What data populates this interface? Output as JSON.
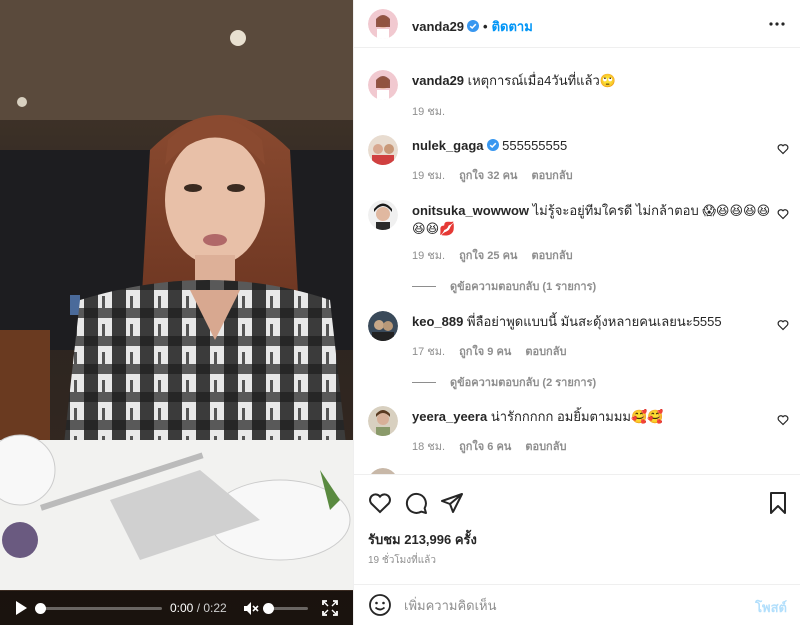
{
  "video": {
    "current_time": "0:00",
    "separator": " / ",
    "duration": "0:22",
    "progress": 0,
    "volume": 0,
    "muted": true
  },
  "header": {
    "username": "vanda29",
    "separator": "•",
    "follow_label": "ติดตาม",
    "more_icon": "more-horizontal-icon"
  },
  "caption": {
    "username": "vanda29",
    "text": "เหตุการณ์เมื่อ4วันที่แล้ว",
    "emoji": "🙄",
    "time": "19 ชม."
  },
  "comments": [
    {
      "username": "nulek_gaga",
      "verified": true,
      "text": "555555555",
      "time": "19 ชม.",
      "likes": "ถูกใจ 32 คน",
      "reply_label": "ตอบกลับ"
    },
    {
      "username": "onitsuka_wowwow",
      "verified": false,
      "text": "ไม่รู้จะอยู่ทีมใครดี ไม่กล้าตอบ",
      "emojis": [
        "😱",
        "😆",
        "😆",
        "😆",
        "😆",
        "😆",
        "😆",
        "💋"
      ],
      "time": "19 ชม.",
      "likes": "ถูกใจ 25 คน",
      "reply_label": "ตอบกลับ",
      "view_replies": "ดูข้อความตอบกลับ (1 รายการ)"
    },
    {
      "username": "keo_889",
      "verified": false,
      "text": "พี่ลือย่าพูดแบบนี้ มันสะดุ้งหลายคนเลยนะ5555",
      "time": "17 ชม.",
      "likes": "ถูกใจ 9 คน",
      "reply_label": "ตอบกลับ",
      "view_replies": "ดูข้อความตอบกลับ (2 รายการ)"
    },
    {
      "username": "yeera_yeera",
      "verified": false,
      "text": "น่ารักกกกก อมยิ้มตามมม",
      "emojis": [
        "🥰",
        "🥰"
      ],
      "time": "18 ชม.",
      "likes": "ถูกใจ 6 คน",
      "reply_label": "ตอบกลับ"
    }
  ],
  "actions": {
    "like_icon": "heart-icon",
    "comment_icon": "comment-icon",
    "share_icon": "share-icon",
    "save_icon": "bookmark-icon",
    "views": "รับชม 213,996 ครั้ง",
    "posted": "19 ชั่วโมงที่แล้ว"
  },
  "add_comment": {
    "placeholder": "เพิ่มความคิดเห็น",
    "post_label": "โพสต์"
  },
  "colors": {
    "accent": "#0095f6",
    "post_disabled": "#b2dffc",
    "muted_text": "#8e8e8e"
  }
}
